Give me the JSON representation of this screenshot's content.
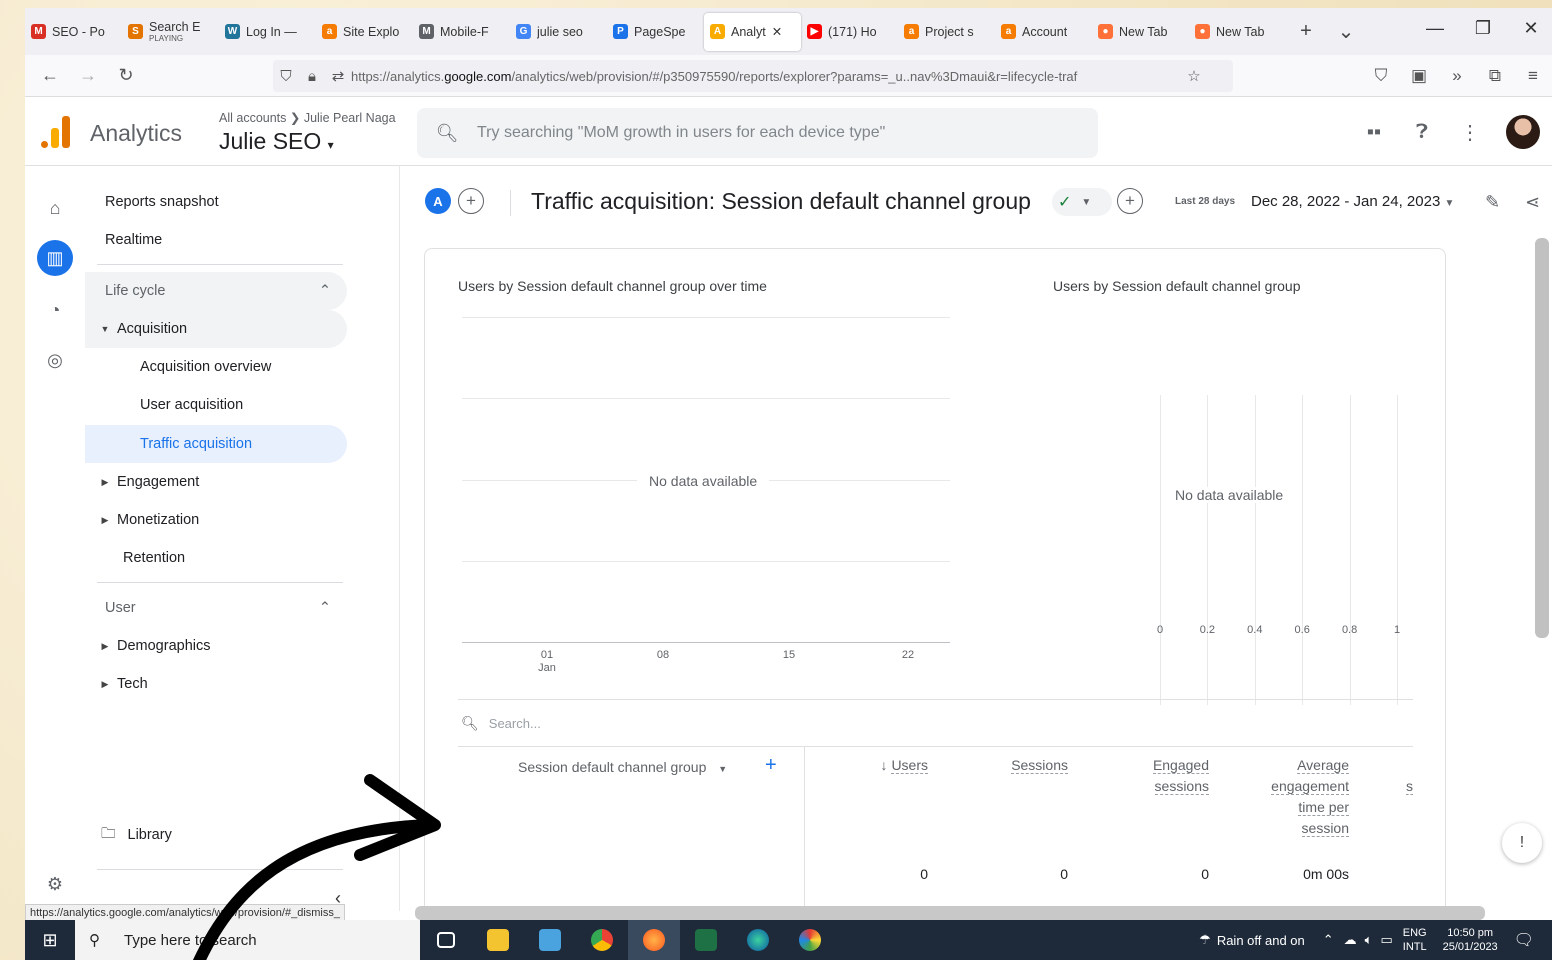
{
  "browser": {
    "tabs": [
      {
        "label": "SEO - Po",
        "fav": "M",
        "color": "#d93025"
      },
      {
        "label": "Search E",
        "sub": "PLAYING",
        "fav": "S",
        "color": "#e37400"
      },
      {
        "label": "Log In —",
        "fav": "W",
        "color": "#21759b"
      },
      {
        "label": "Site Explo",
        "fav": "a",
        "color": "#f57c00"
      },
      {
        "label": "Mobile-F",
        "fav": "M",
        "color": "#5f6368"
      },
      {
        "label": "julie seo",
        "fav": "G",
        "color": "#4285f4"
      },
      {
        "label": "PageSpe",
        "fav": "P",
        "color": "#1a73e8"
      },
      {
        "label": "Analyt",
        "fav": "A",
        "color": "#f9ab00"
      },
      {
        "label": "(171) Ho",
        "fav": "▶",
        "color": "#ff0000"
      },
      {
        "label": "Project s",
        "fav": "a",
        "color": "#f57c00"
      },
      {
        "label": "Account",
        "fav": "a",
        "color": "#f57c00"
      },
      {
        "label": "New Tab",
        "fav": "●",
        "color": "#ff7139"
      },
      {
        "label": "New Tab",
        "fav": "●",
        "color": "#ff7139"
      }
    ],
    "url_prefix": "https://analytics.",
    "url_domain": "google.com",
    "url_rest": "/analytics/web/provision/#/p350975590/reports/explorer?params=_u..nav%3Dmaui&r=lifecycle-traf"
  },
  "header": {
    "product": "Analytics",
    "breadcrumb_root": "All accounts",
    "breadcrumb_account": "Julie Pearl Naga",
    "property": "Julie SEO",
    "search_placeholder": "Try searching \"MoM growth in users for each device type\""
  },
  "sidebar": {
    "reports_snapshot": "Reports snapshot",
    "realtime": "Realtime",
    "lifecycle": "Life cycle",
    "acquisition": "Acquisition",
    "acquisition_overview": "Acquisition overview",
    "user_acquisition": "User acquisition",
    "traffic_acquisition": "Traffic acquisition",
    "engagement": "Engagement",
    "monetization": "Monetization",
    "retention": "Retention",
    "user": "User",
    "demographics": "Demographics",
    "tech": "Tech",
    "library": "Library"
  },
  "report": {
    "avatar_letter": "A",
    "title": "Traffic acquisition: Session default channel group",
    "date_label": "Last 28 days",
    "date_range": "Dec 28, 2022 - Jan 24, 2023",
    "line_chart_title": "Users by Session default channel group over time",
    "bar_chart_title": "Users by Session default channel group",
    "no_data": "No data available",
    "x_ticks": [
      "01",
      "08",
      "15",
      "22"
    ],
    "x_month": "Jan",
    "bar_ticks": [
      "0",
      "0.2",
      "0.4",
      "0.6",
      "0.8",
      "1"
    ],
    "table_search": "Search...",
    "dimension_header": "Session default channel group",
    "col_users": "Users",
    "col_sessions": "Sessions",
    "col_engaged_1": "Engaged",
    "col_engaged_2": "sessions",
    "col_avg_1": "Average",
    "col_avg_2": "engagement",
    "col_avg_3": "time per",
    "col_avg_4": "session",
    "col_trunc": "s",
    "total_users": "0",
    "total_sessions": "0",
    "total_engaged": "0",
    "total_avg": "0m 00s"
  },
  "status_url": "https://analytics.google.com/analytics/web/provision/#_dismiss_",
  "taskbar": {
    "search_placeholder": "Type here to search",
    "weather": "Rain off and on",
    "lang_1": "ENG",
    "lang_2": "INTL",
    "time": "10:50 pm",
    "date": "25/01/2023"
  },
  "colors": {
    "ga_blue": "#1a73e8",
    "selected_nav_bg": "#e8f0fe",
    "active_group_bg": "#f1f3f4"
  }
}
